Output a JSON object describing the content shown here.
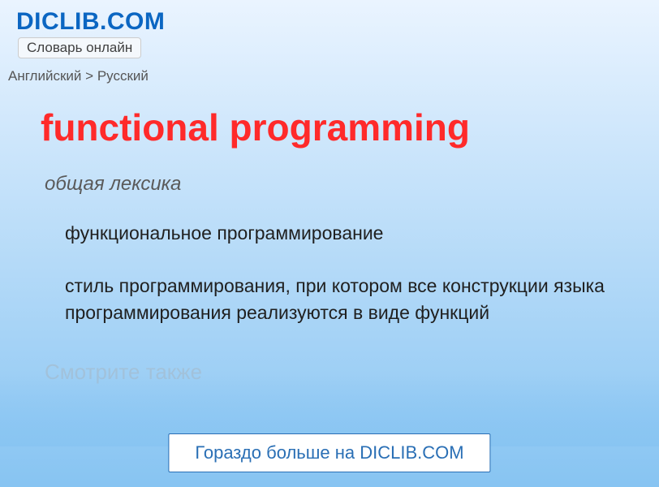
{
  "header": {
    "logo": "DICLIB.COM",
    "tagline": "Словарь онлайн"
  },
  "breadcrumb": {
    "from": "Английский",
    "sep": ">",
    "to": "Русский"
  },
  "entry": {
    "title": "functional programming",
    "category": "общая лексика",
    "definitions": [
      "функциональное программирование",
      "стиль программирования, при котором все конструкции языка программирования реализуются в виде функций"
    ],
    "see_also_label": "Смотрите также"
  },
  "footer": {
    "more_link": "Гораздо больше на DICLIB.COM"
  }
}
